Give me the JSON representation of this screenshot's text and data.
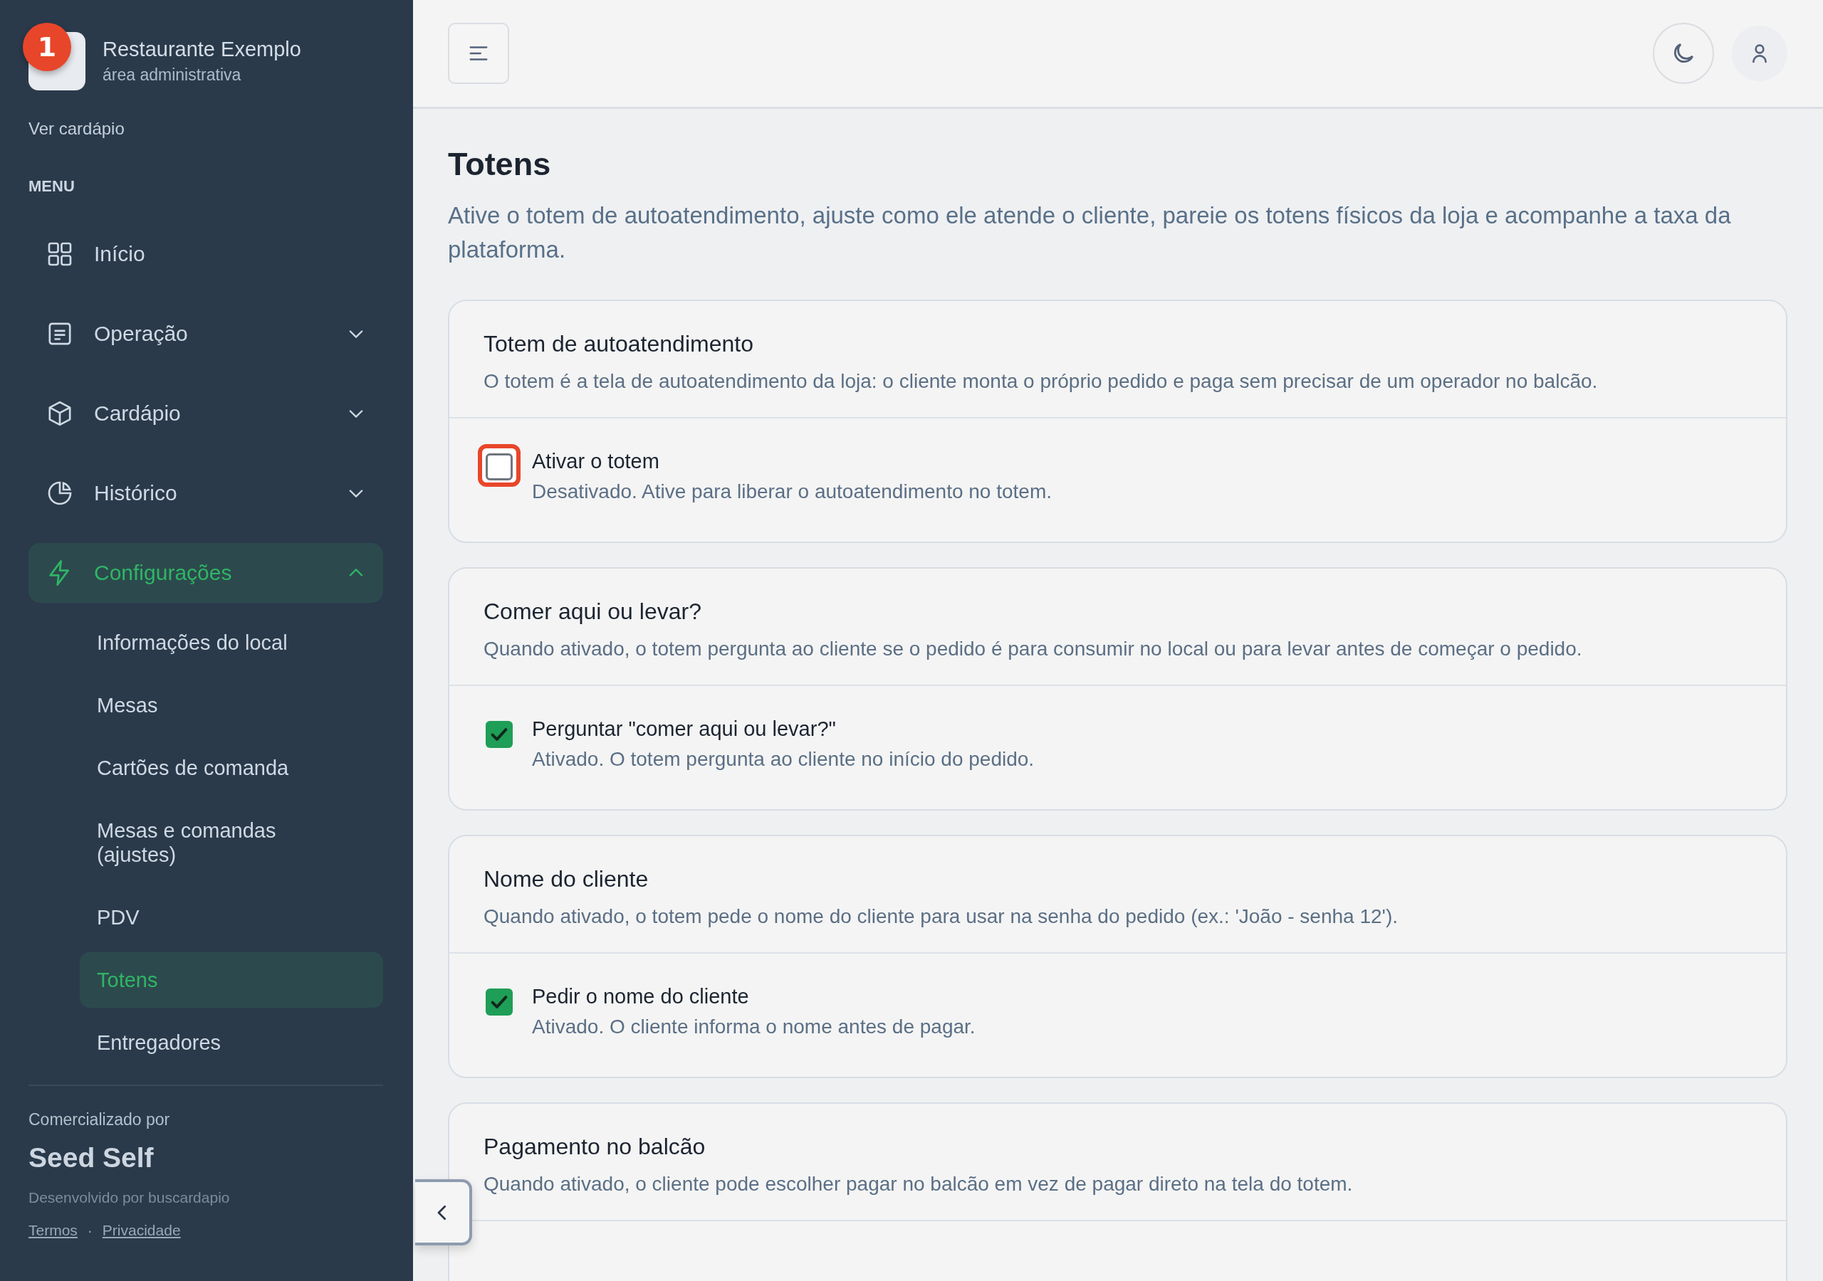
{
  "sidebar": {
    "brand": {
      "name": "Restaurante Exemplo",
      "subtitle": "área administrativa",
      "step_badge": "1"
    },
    "menu_link": "Ver cardápio",
    "menu_heading": "MENU",
    "items": [
      {
        "label": "Início",
        "kind": "link",
        "selected": false
      },
      {
        "label": "Operação",
        "kind": "group",
        "expanded": false,
        "selected": false
      },
      {
        "label": "Cardápio",
        "kind": "group",
        "expanded": false,
        "selected": false
      },
      {
        "label": "Histórico",
        "kind": "group",
        "expanded": false,
        "selected": false
      },
      {
        "label": "Configurações",
        "kind": "group",
        "expanded": true,
        "selected": true,
        "children": [
          {
            "label": "Informações do local",
            "selected": false
          },
          {
            "label": "Mesas",
            "selected": false
          },
          {
            "label": "Cartões de comanda",
            "selected": false
          },
          {
            "label": "Mesas e comandas (ajustes)",
            "selected": false
          },
          {
            "label": "PDV",
            "selected": false
          },
          {
            "label": "Totens",
            "selected": true
          },
          {
            "label": "Entregadores",
            "selected": false
          }
        ]
      }
    ],
    "footer": {
      "caption": "Comercializado por",
      "product": "Seed Self",
      "credit": "Desenvolvido por buscardapio",
      "links": [
        "Termos",
        "Privacidade"
      ],
      "separator": "·"
    }
  },
  "page": {
    "title": "Totens",
    "description": "Ative o totem de autoatendimento, ajuste como ele atende o cliente, pareie os totens físicos da loja e acompanhe a taxa da plataforma."
  },
  "cards": [
    {
      "title": "Totem de autoatendimento",
      "description": "O totem é a tela de autoatendimento da loja: o cliente monta o próprio pedido e paga sem precisar de um operador no balcão.",
      "options": [
        {
          "label": "Ativar o totem",
          "hint": "Desativado. Ative para liberar o autoatendimento no totem.",
          "checked": false,
          "highlighted": true
        }
      ]
    },
    {
      "title": "Comer aqui ou levar?",
      "description": "Quando ativado, o totem pergunta ao cliente se o pedido é para consumir no local ou para levar antes de começar o pedido.",
      "options": [
        {
          "label": "Perguntar \"comer aqui ou levar?\"",
          "hint": "Ativado. O totem pergunta ao cliente no início do pedido.",
          "checked": true,
          "highlighted": false
        }
      ]
    },
    {
      "title": "Nome do cliente",
      "description": "Quando ativado, o totem pede o nome do cliente para usar na senha do pedido (ex.: 'João - senha 12').",
      "options": [
        {
          "label": "Pedir o nome do cliente",
          "hint": "Ativado. O cliente informa o nome antes de pagar.",
          "checked": true,
          "highlighted": false
        }
      ]
    },
    {
      "title": "Pagamento no balcão",
      "description": "Quando ativado, o cliente pode escolher pagar no balcão em vez de pagar direto na tela do totem."
    }
  ]
}
